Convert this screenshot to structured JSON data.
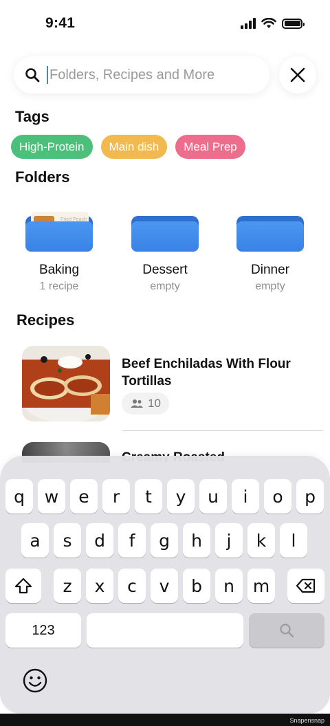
{
  "status_bar": {
    "time": "9:41"
  },
  "search": {
    "placeholder": "Folders, Recipes and More",
    "value": ""
  },
  "sections": {
    "tags": "Tags",
    "folders": "Folders",
    "recipes": "Recipes"
  },
  "tags": [
    {
      "label": "High-Protein",
      "color": "#4cbf7a"
    },
    {
      "label": "Main dish",
      "color": "#f2b94e"
    },
    {
      "label": "Meal Prep",
      "color": "#ef6d8c"
    }
  ],
  "folders": [
    {
      "name": "Baking",
      "count": "1 recipe",
      "thumb_text": "Fried Peach Co..."
    },
    {
      "name": "Dessert",
      "count": "empty"
    },
    {
      "name": "Dinner",
      "count": "empty"
    }
  ],
  "recipes": [
    {
      "title": "Beef Enchiladas With Flour Tortillas",
      "servings": "10"
    },
    {
      "title": "Creamy Roasted"
    }
  ],
  "keyboard": {
    "row1": [
      "q",
      "w",
      "e",
      "r",
      "t",
      "y",
      "u",
      "i",
      "o",
      "p"
    ],
    "row2": [
      "a",
      "s",
      "d",
      "f",
      "g",
      "h",
      "j",
      "k",
      "l"
    ],
    "row3": [
      "z",
      "x",
      "c",
      "v",
      "b",
      "n",
      "m"
    ],
    "numbers_key": "123"
  },
  "watermark": "Snapensnap"
}
